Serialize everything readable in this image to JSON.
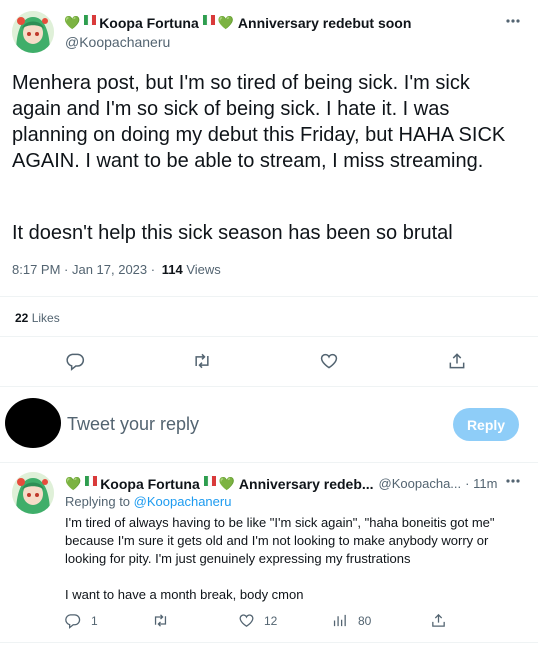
{
  "tweet": {
    "emoji_heart": "💚",
    "emoji_flag": "🇮🇹",
    "display_name": "Koopa Fortuna",
    "name_suffix": "Anniversary redebut soon",
    "handle": "@Koopachaneru",
    "text_p1": "Menhera post, but I'm so tired of being sick. I'm sick again and I'm so sick of being sick. I hate it. I was planning on doing my debut this Friday, but HAHA SICK AGAIN. I want to be able to stream, I miss streaming.",
    "text_p2": "It doesn't help this sick season has been so brutal",
    "timestamp": "8:17 PM · Jan 17, 2023 ·",
    "views_count": "114",
    "views_label": "Views",
    "likes_count": "22",
    "likes_label": "Likes"
  },
  "composer": {
    "placeholder": "Tweet your reply",
    "reply_button": "Reply"
  },
  "reply": {
    "display_name": "Koopa Fortuna",
    "name_suffix": "Anniversary redeb...",
    "handle": "@Koopacha...",
    "time": "· 11m",
    "replying_label": "Replying to",
    "replying_handle": "@Koopachaneru",
    "text_p1": "I'm tired of always having to be like \"I'm sick again\", \"haha boneitis got me\" because I'm sure it gets old and I'm not looking to make anybody worry or looking for pity. I'm just genuinely expressing my frustrations",
    "text_p2": "I want to have a month break, body cmon",
    "reply_count": "1",
    "like_count": "12",
    "views_count": "80"
  },
  "icons": {
    "more": "more-icon",
    "reply": "reply-icon",
    "retweet": "retweet-icon",
    "like": "like-icon",
    "share": "share-icon",
    "views": "views-icon"
  },
  "colors": {
    "accent": "#1d9bf0",
    "reply_button_disabled": "#8ecdf8",
    "secondary_text": "#536471",
    "divider": "#eff3f4"
  }
}
